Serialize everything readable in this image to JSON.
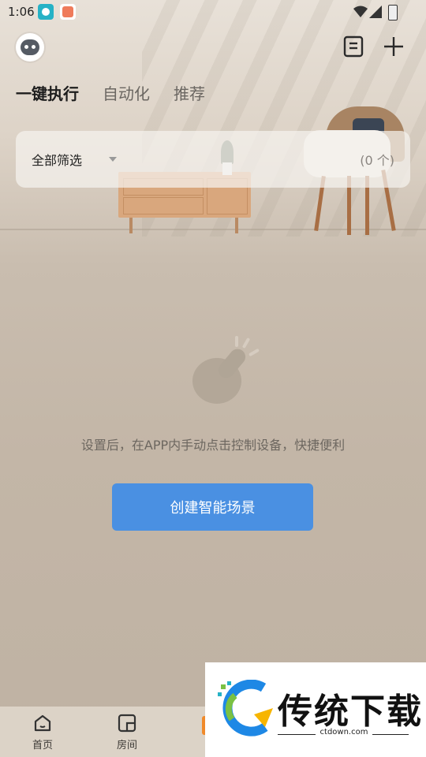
{
  "status_bar": {
    "time": "1:06"
  },
  "tabs": [
    {
      "label": "一键执行",
      "active": true
    },
    {
      "label": "自动化",
      "active": false
    },
    {
      "label": "推荐",
      "active": false
    }
  ],
  "filter": {
    "label": "全部筛选",
    "count": "(0 个)"
  },
  "empty_state": {
    "message": "设置后，在APP内手动点击控制设备，快捷便利",
    "button_label": "创建智能场景"
  },
  "bottom_nav": [
    {
      "label": "首页",
      "icon": "home-icon"
    },
    {
      "label": "房间",
      "icon": "room-icon"
    }
  ],
  "watermark": {
    "title": "传统下载",
    "url": "ctdown.com"
  },
  "colors": {
    "accent": "#4a90e2",
    "nav_highlight": "#f08a2a"
  }
}
